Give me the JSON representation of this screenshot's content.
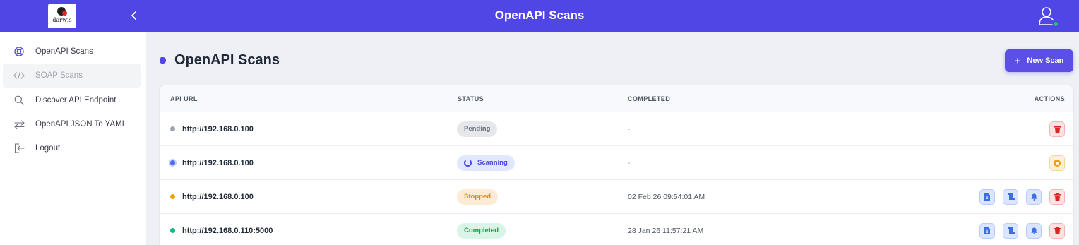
{
  "header": {
    "logo_text": "darwis",
    "title": "OpenAPI Scans",
    "collapse_icon": "chevron-left-icon",
    "user_icon": "user-icon",
    "status_color": "#22c55e",
    "brand_color": "#4f46e5"
  },
  "sidebar": {
    "items": [
      {
        "label": "OpenAPI Scans",
        "icon": "lifebuoy-icon"
      },
      {
        "label": "SOAP Scans",
        "icon": "code-icon"
      },
      {
        "label": "Discover API Endpoint",
        "icon": "search-icon"
      },
      {
        "label": "OpenAPI JSON To YAML",
        "icon": "swap-icon"
      },
      {
        "label": "Logout",
        "icon": "logout-icon"
      }
    ]
  },
  "main": {
    "title": "OpenAPI Scans",
    "new_scan_label": "New Scan",
    "table": {
      "headers": {
        "url": "API URL",
        "status": "STATUS",
        "completed": "COMPLETED",
        "actions": "ACTIONS"
      },
      "rows": [
        {
          "url": "http://192.168.0.100",
          "status": "Pending",
          "completed": "-",
          "dot_color": "#9ca3af",
          "actions": [
            "delete"
          ]
        },
        {
          "url": "http://192.168.0.100",
          "status": "Scanning",
          "completed": "-",
          "dot_color": "#4f6bf5",
          "actions": [
            "stop"
          ]
        },
        {
          "url": "http://192.168.0.100",
          "status": "Stopped",
          "completed": "02 Feb 26 09:54:01 AM",
          "dot_color": "#f59e0b",
          "actions": [
            "download-report",
            "view-scroll",
            "notify",
            "delete"
          ]
        },
        {
          "url": "http://192.168.0.110:5000",
          "status": "Completed",
          "completed": "28 Jan 26 11:57:21 AM",
          "dot_color": "#10b981",
          "actions": [
            "download-report",
            "view-scroll",
            "notify",
            "delete"
          ]
        }
      ]
    }
  }
}
